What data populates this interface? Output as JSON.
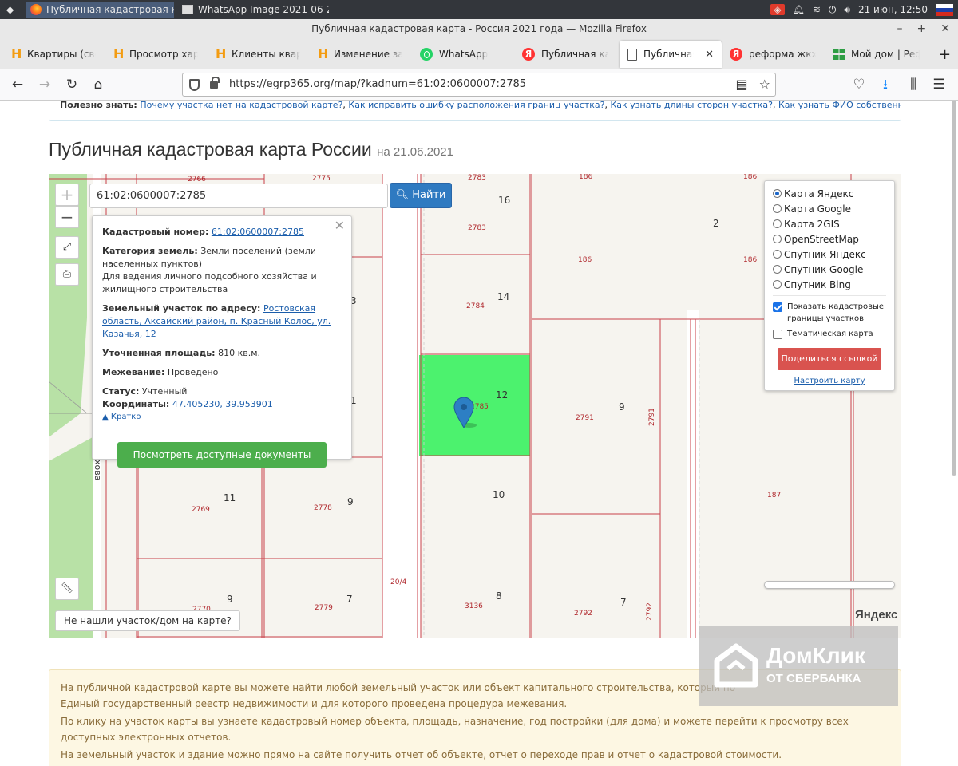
{
  "os_panel": {
    "tasks": [
      {
        "label": "Публичная кадастровая ка..."
      },
      {
        "label": "WhatsApp Image 2021-06-2..."
      }
    ],
    "datetime": "21 июн, 12:50"
  },
  "window": {
    "title": "Публичная кадастровая карта - Россия 2021 года — Mozilla Firefox"
  },
  "tabs": [
    {
      "label": "Квартиры (свои",
      "icon": "h-icon"
    },
    {
      "label": "Просмотр характ",
      "icon": "h-icon"
    },
    {
      "label": "Клиенты квартиры",
      "icon": "h-icon"
    },
    {
      "label": "Изменение запи",
      "icon": "h-icon"
    },
    {
      "label": "WhatsApp",
      "icon": "whatsapp-icon"
    },
    {
      "label": "Публичная када",
      "icon": "yandex-icon"
    },
    {
      "label": "Публичная ка",
      "icon": "document-icon",
      "active": true
    },
    {
      "label": "реформа жкх са",
      "icon": "yandex-icon"
    },
    {
      "label": "Мой дом | Рефо",
      "icon": "grid-icon"
    }
  ],
  "url": "https://egrp365.org/map/?kadnum=61:02:0600007:2785",
  "tipbar": {
    "label": "Полезно знать:",
    "links": [
      "Почему участка нет на кадастровой карте?",
      "Как исправить ошибку расположения границ участка?",
      "Как узнать длины сторон участка?",
      "Как узнать ФИО собственника участка?"
    ]
  },
  "page_title": "Публичная кадастровая карта России",
  "page_date": "на 21.06.2021",
  "map": {
    "search_value": "61:02:0600007:2785",
    "search_button": "Найти",
    "plot_numbers": [
      "16",
      "2",
      "14",
      "12",
      "9",
      "10",
      "11",
      "9",
      "9",
      "7",
      "8",
      "7",
      "3",
      "1"
    ],
    "cadastral_numbers": [
      "2766",
      "2775",
      "2783",
      "186",
      "186",
      "2783",
      "186",
      "186",
      "2784",
      "2785",
      "2791",
      "2791",
      "2769",
      "2778",
      "187",
      "2770",
      "2779",
      "20/4",
      "3136",
      "2792",
      "2792"
    ],
    "street_label": "хова",
    "not_found_button": "Не нашли участок/дом на карте?",
    "yandex_logo": "Яндекс"
  },
  "info_popup": {
    "cadnum_label": "Кадастровый номер:",
    "cadnum_value": "61:02:0600007:2785",
    "category_label": "Категория земель:",
    "category_value": "Земли поселений (земли населенных пунктов)",
    "usage_value": "Для ведения личного подсобного хозяйства и жилищного строительства",
    "address_label": "Земельный участок по адресу:",
    "address_value": "Ростовская область, Аксайский район, п. Красный Колос, ул. Казачья, 12",
    "area_label": "Уточненная площадь:",
    "area_value": "810 кв.м.",
    "survey_label": "Межевание:",
    "survey_value": "Проведено",
    "status_label": "Статус:",
    "status_value": "Учтенный",
    "coords_label": "Координаты:",
    "coords_value": "47.405230, 39.953901",
    "short_link": "Кратко",
    "docs_button": "Посмотреть доступные документы"
  },
  "layers": {
    "options": [
      {
        "label": "Карта Яндекс",
        "selected": true
      },
      {
        "label": "Карта Google",
        "selected": false
      },
      {
        "label": "Карта 2GIS",
        "selected": false
      },
      {
        "label": "OpenStreetMap",
        "selected": false
      },
      {
        "label": "Спутник Яндекс",
        "selected": false
      },
      {
        "label": "Спутник Google",
        "selected": false
      },
      {
        "label": "Спутник Bing",
        "selected": false
      }
    ],
    "show_borders": "Показать кадастровые границы участков",
    "thematic": "Тематическая карта",
    "share_button": "Поделиться ссылкой",
    "configure_link": "Настроить карту"
  },
  "notice": {
    "p1": "На публичной кадастровой карте вы можете найти любой земельный участок или объект капитального строительства, который по",
    "p1b": "Единый государственный реестр недвижимости и для которого проведена процедура межевания.",
    "p2": "По клику на участок карты вы узнаете кадастровый номер объекта, площадь, назначение, год постройки (для дома) и можете перейти к просмотру всех доступных электронных отчетов.",
    "p3": "На земельный участок и здание можно прямо на сайте получить отчет об объекте, отчет о переходе прав и отчет о кадастровой стоимости."
  },
  "watermark": {
    "line1": "ДомКлик",
    "line2": "ОТ СБЕРБАНКА"
  },
  "colors": {
    "selected_parcel": "#4cf26e",
    "boundary": "#c8404a",
    "search_button": "#2f7ac1",
    "docs_button": "#4cae4c",
    "share_button": "#d9534f"
  }
}
